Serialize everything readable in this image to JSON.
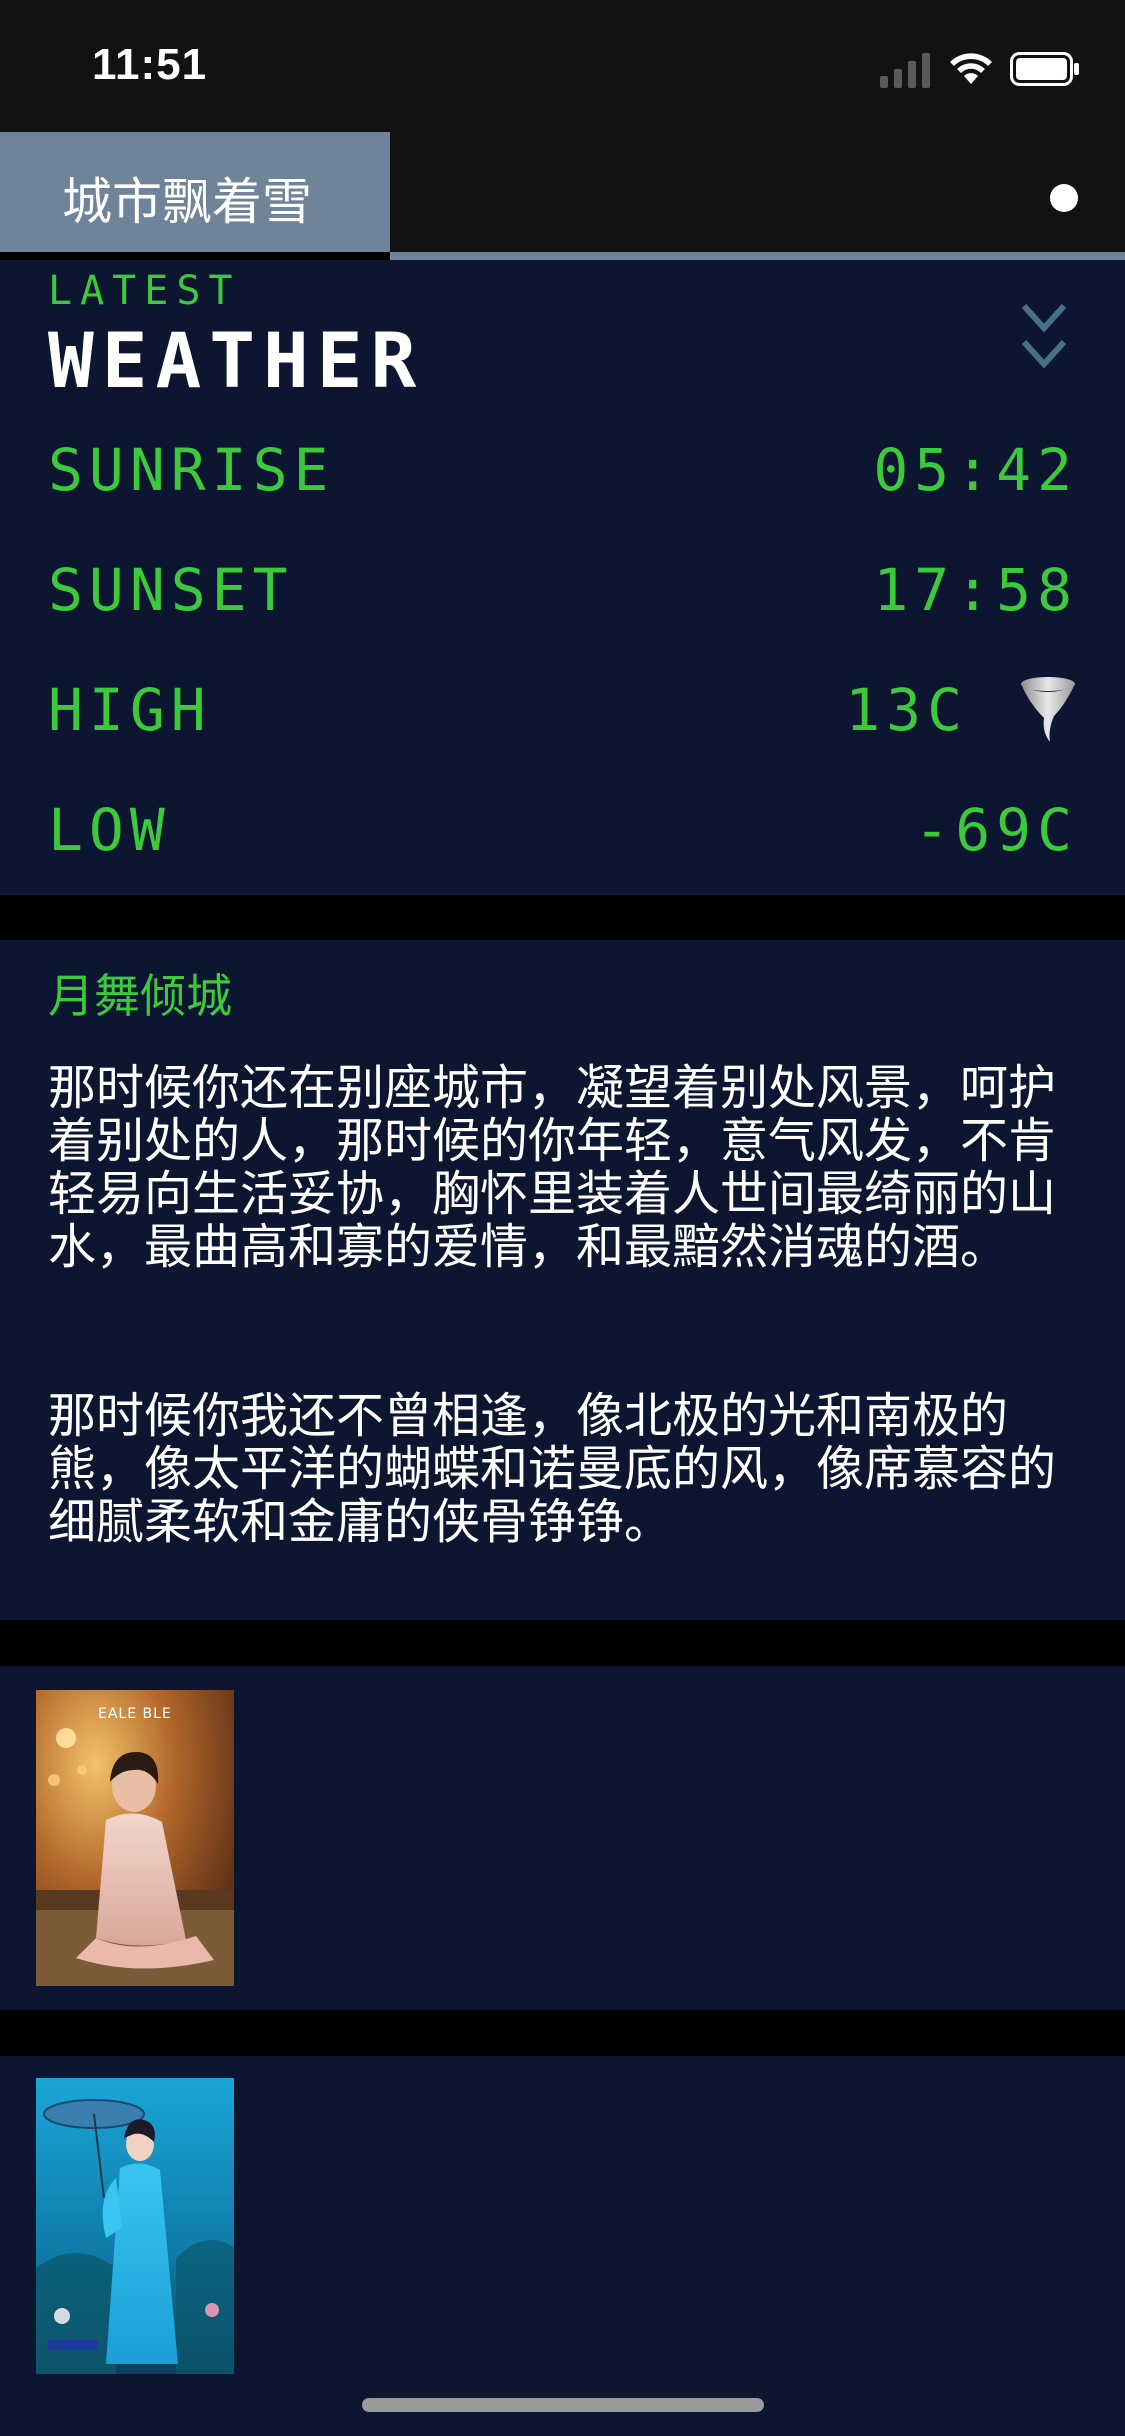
{
  "status_bar": {
    "time": "11:51"
  },
  "nav": {
    "title": "城市飘着雪"
  },
  "weather": {
    "kicker": "LATEST",
    "title": "WEATHER",
    "rows": [
      {
        "label": "SUNRISE",
        "value": "05:42"
      },
      {
        "label": "SUNSET",
        "value": "17:58"
      },
      {
        "label": "HIGH",
        "value": "13C"
      },
      {
        "label": "LOW",
        "value": "-69C"
      }
    ],
    "high_icon": "tornado-icon",
    "accent_color": "#3cc93c",
    "card_color": "#0c1631"
  },
  "article": {
    "title": "月舞倾城",
    "paragraphs": [
      "那时候你还在别座城市，凝望着别处风景，呵护着别处的人，那时候的你年轻，意气风发，不肯轻易向生活妥协，胸怀里装着人世间最绮丽的山水，最曲高和寡的爱情，和最黯然消魂的酒。",
      "那时候你我还不曾相逢，像北极的光和南极的熊，像太平洋的蝴蝶和诺曼底的风，像席慕容的细腻柔软和金庸的侠骨铮铮。"
    ]
  },
  "photos": [
    {
      "logo_text": "EALE BLE"
    },
    {
      "logo_text": ""
    }
  ]
}
